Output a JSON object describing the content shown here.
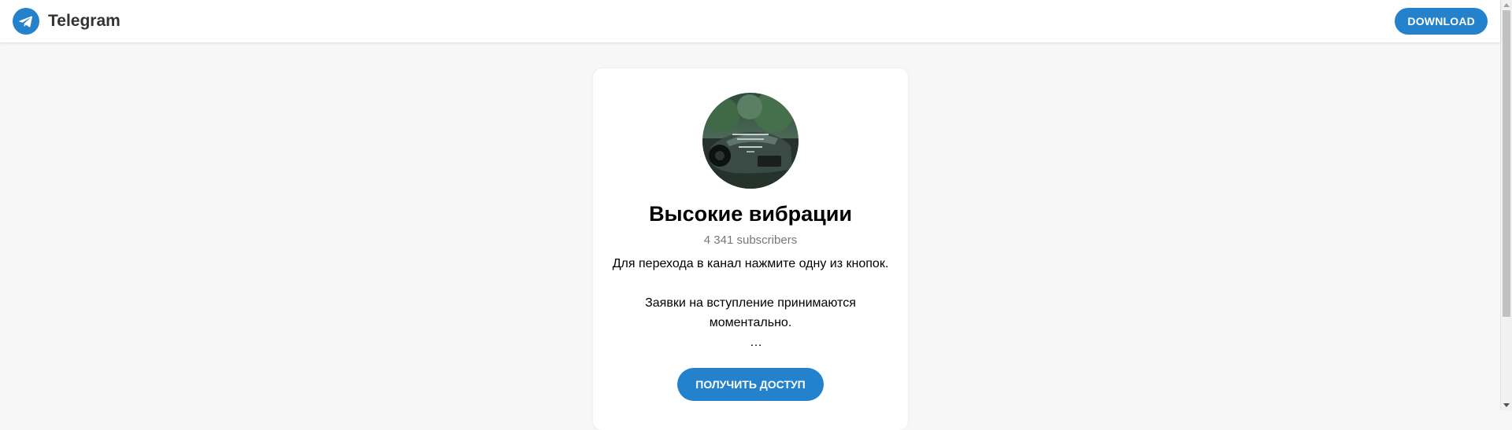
{
  "header": {
    "brand_name": "Telegram",
    "brand_icon": "telegram-plane-icon",
    "download_label": "DOWNLOAD"
  },
  "channel": {
    "title": "Высокие вибрации",
    "subscribers": "4 341 subscribers",
    "description_line1": "Для перехода в канал нажмите одну из кнопок.",
    "description_line2": "Заявки на вступление принимаются моментально.",
    "description_line3": "…",
    "access_button_label": "ПОЛУЧИТЬ ДОСТУП"
  },
  "colors": {
    "accent": "#2481cc",
    "page_background": "#f7f7f7",
    "muted_text": "#777777"
  }
}
